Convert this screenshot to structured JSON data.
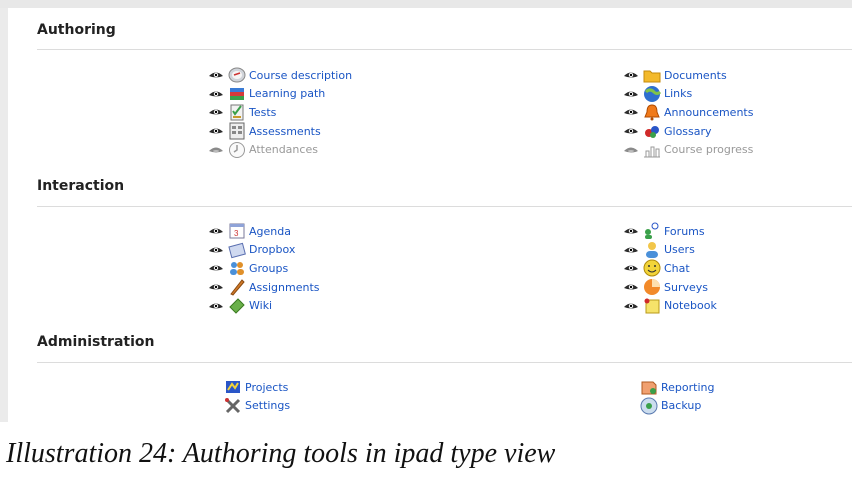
{
  "sections": {
    "authoring": {
      "title": "Authoring",
      "left": [
        {
          "label": "Course description",
          "icon": "course-description-icon",
          "visible": true
        },
        {
          "label": "Learning path",
          "icon": "learning-path-icon",
          "visible": true
        },
        {
          "label": "Tests",
          "icon": "tests-icon",
          "visible": true
        },
        {
          "label": "Assessments",
          "icon": "assessments-icon",
          "visible": true
        },
        {
          "label": "Attendances",
          "icon": "attendances-icon",
          "visible": false
        }
      ],
      "right": [
        {
          "label": "Documents",
          "icon": "documents-icon",
          "visible": true
        },
        {
          "label": "Links",
          "icon": "links-icon",
          "visible": true
        },
        {
          "label": "Announcements",
          "icon": "announcements-icon",
          "visible": true
        },
        {
          "label": "Glossary",
          "icon": "glossary-icon",
          "visible": true
        },
        {
          "label": "Course progress",
          "icon": "course-progress-icon",
          "visible": false
        }
      ]
    },
    "interaction": {
      "title": "Interaction",
      "left": [
        {
          "label": "Agenda",
          "icon": "agenda-icon",
          "visible": true
        },
        {
          "label": "Dropbox",
          "icon": "dropbox-icon",
          "visible": true
        },
        {
          "label": "Groups",
          "icon": "groups-icon",
          "visible": true
        },
        {
          "label": "Assignments",
          "icon": "assignments-icon",
          "visible": true
        },
        {
          "label": "Wiki",
          "icon": "wiki-icon",
          "visible": true
        }
      ],
      "right": [
        {
          "label": "Forums",
          "icon": "forums-icon",
          "visible": true
        },
        {
          "label": "Users",
          "icon": "users-icon",
          "visible": true
        },
        {
          "label": "Chat",
          "icon": "chat-icon",
          "visible": true
        },
        {
          "label": "Surveys",
          "icon": "surveys-icon",
          "visible": true
        },
        {
          "label": "Notebook",
          "icon": "notebook-icon",
          "visible": true
        }
      ]
    },
    "administration": {
      "title": "Administration",
      "left": [
        {
          "label": "Projects",
          "icon": "projects-icon"
        },
        {
          "label": "Settings",
          "icon": "settings-icon"
        }
      ],
      "right": [
        {
          "label": "Reporting",
          "icon": "reporting-icon"
        },
        {
          "label": "Backup",
          "icon": "backup-icon"
        }
      ]
    }
  },
  "caption": "Illustration 24: Authoring tools in ipad type view",
  "colors": {
    "link": "#1a55c4",
    "muted": "#999999",
    "divider": "#dcdcdc"
  }
}
